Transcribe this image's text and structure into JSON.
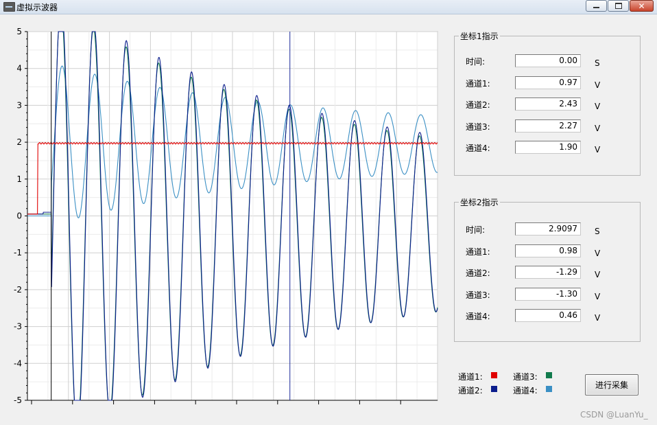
{
  "window": {
    "title": "虚拟示波器",
    "app_icon": "oscilloscope-icon",
    "buttons": [
      "minimize-icon",
      "maximize-icon",
      "close-icon"
    ]
  },
  "plot": {
    "y_tick_labels": [
      "5",
      "4",
      "3",
      "2",
      "1",
      "0",
      "-1",
      "-2",
      "-3",
      "-4",
      "-5"
    ],
    "ylim": [
      -5,
      5
    ],
    "xlim": [
      0,
      1
    ],
    "grid": true,
    "cursor1_x": 0.058,
    "cursor2_x": 0.64,
    "colors": {
      "ch1": "#e00000",
      "ch2": "#0b1d8c",
      "ch3": "#117a4c",
      "ch4": "#3a8fc4",
      "cursor1": "#000000",
      "cursor2": "#1a2a9a",
      "grid": "#d0d0d0"
    }
  },
  "chart_data": {
    "type": "line",
    "ylim": [
      -5,
      5
    ],
    "grid": true,
    "series": [
      {
        "name": "通道1",
        "description": "step from 0 to ~1.97 near start"
      },
      {
        "name": "通道2",
        "description": "damped oscillation ~±4.9 decaying to ~±2"
      },
      {
        "name": "通道3",
        "description": "damped oscillation overlapping 通道2"
      },
      {
        "name": "通道4",
        "description": "oscillation around ~1.9 with amplitude decaying from ~1.8 to ~0.7"
      }
    ]
  },
  "cursor1": {
    "title": "坐标1指示",
    "rows": [
      {
        "label": "时间:",
        "value": "0.00",
        "unit": "S"
      },
      {
        "label": "通道1:",
        "value": "0.97",
        "unit": "V"
      },
      {
        "label": "通道2:",
        "value": "2.43",
        "unit": "V"
      },
      {
        "label": "通道3:",
        "value": "2.27",
        "unit": "V"
      },
      {
        "label": "通道4:",
        "value": "1.90",
        "unit": "V"
      }
    ]
  },
  "cursor2": {
    "title": "坐标2指示",
    "rows": [
      {
        "label": "时间:",
        "value": "2.9097",
        "unit": "S"
      },
      {
        "label": "通道1:",
        "value": "0.98",
        "unit": "V"
      },
      {
        "label": "通道2:",
        "value": "-1.29",
        "unit": "V"
      },
      {
        "label": "通道3:",
        "value": "-1.30",
        "unit": "V"
      },
      {
        "label": "通道4:",
        "value": "0.46",
        "unit": "V"
      }
    ]
  },
  "legend": [
    {
      "label": "通道1:",
      "color": "#e00000"
    },
    {
      "label": "通道3:",
      "color": "#117a4c"
    },
    {
      "label": "通道2:",
      "color": "#0b1d8c"
    },
    {
      "label": "通道4:",
      "color": "#3a8fc4"
    }
  ],
  "collect_button": "进行采集",
  "watermark": "CSDN @LuanYu_"
}
